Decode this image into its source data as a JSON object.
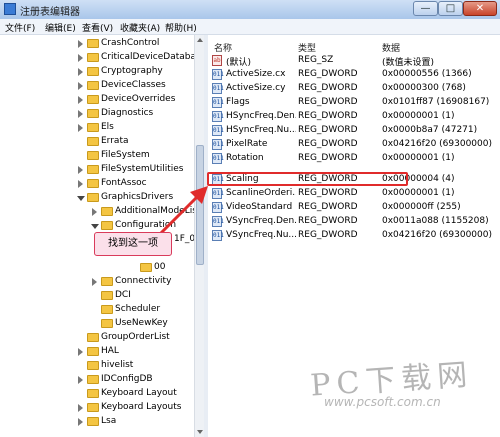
{
  "window": {
    "title": "注册表编辑器",
    "min_glyph": "—",
    "max_glyph": "□",
    "close_glyph": "✕"
  },
  "menu": [
    "文件(F)",
    "编辑(E)",
    "查看(V)",
    "收藏夹(A)",
    "帮助(H)"
  ],
  "tree": {
    "items": [
      {
        "label": "CrashControl"
      },
      {
        "label": "CriticalDeviceDatabase"
      },
      {
        "label": "Cryptography"
      },
      {
        "label": "DeviceClasses"
      },
      {
        "label": "DeviceOverrides"
      },
      {
        "label": "Diagnostics"
      },
      {
        "label": "Els"
      },
      {
        "label": "Errata"
      },
      {
        "label": "FileSystem"
      },
      {
        "label": "FileSystemUtilities"
      },
      {
        "label": "FontAssoc"
      },
      {
        "label": "GraphicsDrivers"
      },
      {
        "label": "AdditionalModeLis"
      },
      {
        "label": "Configuration"
      },
      {
        "label": "1F_0"
      },
      {
        "label": "00"
      },
      {
        "label": "Connectivity"
      },
      {
        "label": "DCI"
      },
      {
        "label": "Scheduler"
      },
      {
        "label": "UseNewKey"
      },
      {
        "label": "GroupOrderList"
      },
      {
        "label": "HAL"
      },
      {
        "label": "hivelist"
      },
      {
        "label": "IDConfigDB"
      },
      {
        "label": "Keyboard Layout"
      },
      {
        "label": "Keyboard Layouts"
      },
      {
        "label": "Lsa"
      }
    ]
  },
  "list": {
    "headers": {
      "name": "名称",
      "type": "类型",
      "data": "数据"
    },
    "rows": [
      {
        "name": "(默认)",
        "type": "REG_SZ",
        "data": "(数值未设置)",
        "icon": "string-value-icon",
        "glyph": "ab"
      },
      {
        "name": "ActiveSize.cx",
        "type": "REG_DWORD",
        "data": "0x00000556 (1366)",
        "icon": "dword-value-icon",
        "glyph": "011"
      },
      {
        "name": "ActiveSize.cy",
        "type": "REG_DWORD",
        "data": "0x00000300 (768)",
        "icon": "dword-value-icon",
        "glyph": "011"
      },
      {
        "name": "Flags",
        "type": "REG_DWORD",
        "data": "0x0101ff87 (16908167)",
        "icon": "dword-value-icon",
        "glyph": "011"
      },
      {
        "name": "HSyncFreq.Den...",
        "type": "REG_DWORD",
        "data": "0x00000001 (1)",
        "icon": "dword-value-icon",
        "glyph": "011"
      },
      {
        "name": "HSyncFreq.Nu...",
        "type": "REG_DWORD",
        "data": "0x0000b8a7 (47271)",
        "icon": "dword-value-icon",
        "glyph": "011"
      },
      {
        "name": "PixelRate",
        "type": "REG_DWORD",
        "data": "0x04216f20 (69300000)",
        "icon": "dword-value-icon",
        "glyph": "011"
      },
      {
        "name": "Rotation",
        "type": "REG_DWORD",
        "data": "0x00000001 (1)",
        "icon": "dword-value-icon",
        "glyph": "011"
      },
      {
        "name": "Scaling",
        "type": "REG_DWORD",
        "data": "0x00000004 (4)",
        "icon": "dword-value-icon",
        "glyph": "011"
      },
      {
        "name": "ScanlineOrderi...",
        "type": "REG_DWORD",
        "data": "0x00000001 (1)",
        "icon": "dword-value-icon",
        "glyph": "011"
      },
      {
        "name": "VideoStandard",
        "type": "REG_DWORD",
        "data": "0x000000ff (255)",
        "icon": "dword-value-icon",
        "glyph": "011"
      },
      {
        "name": "VSyncFreq.Den...",
        "type": "REG_DWORD",
        "data": "0x0011a088 (1155208)",
        "icon": "dword-value-icon",
        "glyph": "011"
      },
      {
        "name": "VSyncFreq.Nu...",
        "type": "REG_DWORD",
        "data": "0x04216f20 (69300000)",
        "icon": "dword-value-icon",
        "glyph": "011"
      }
    ]
  },
  "annotation": {
    "callout_text": "找到这一项",
    "color": "#e02b2b"
  },
  "watermark": {
    "main": "PC下载网",
    "sub": "www.pcsoft.com.cn"
  }
}
